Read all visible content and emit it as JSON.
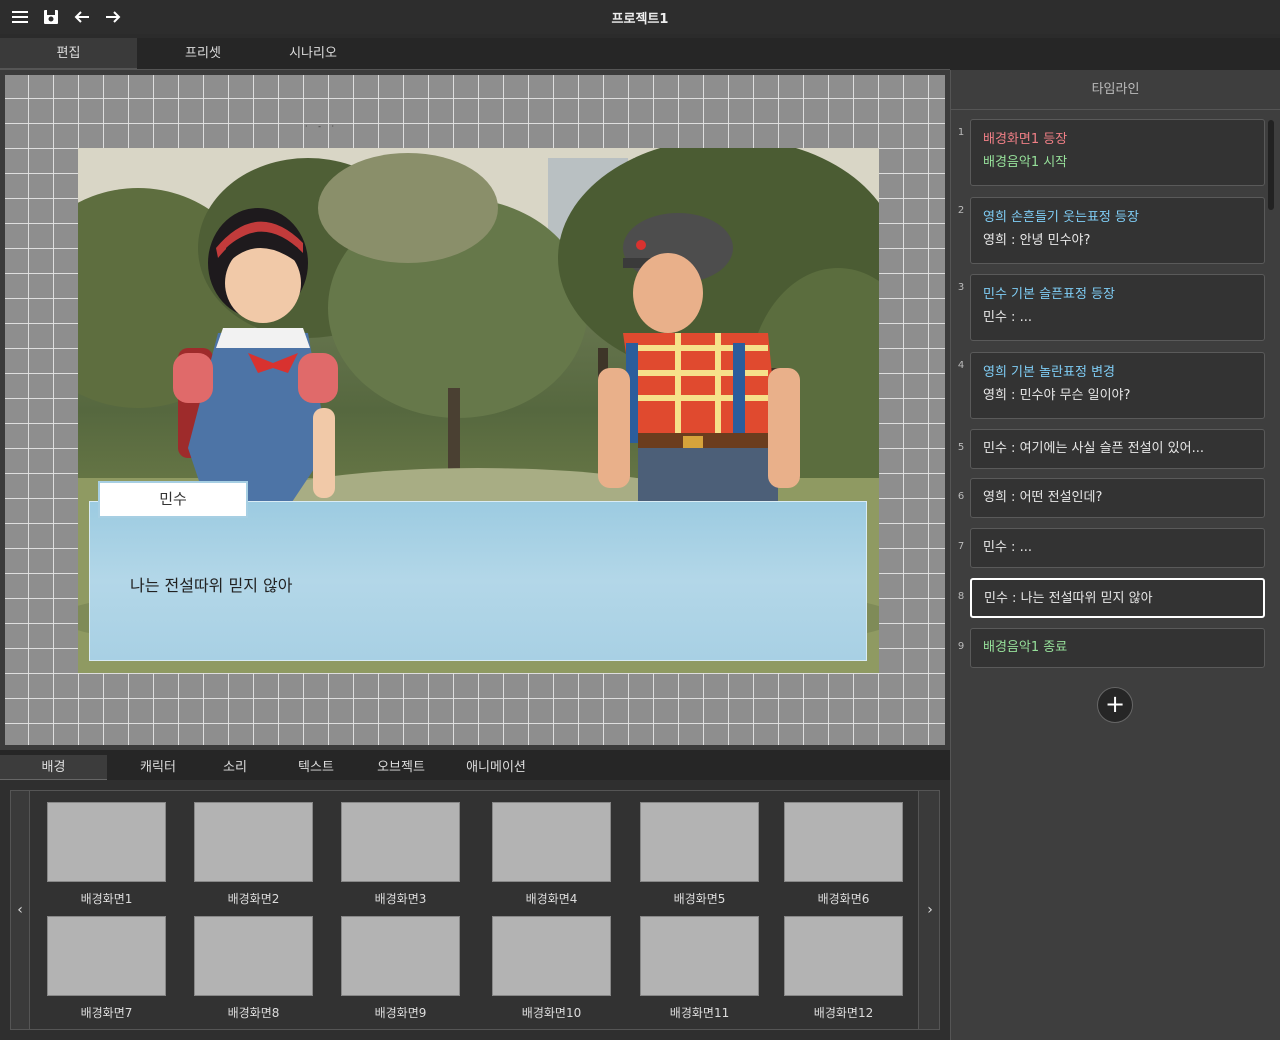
{
  "app": {
    "title": "프로젝트1"
  },
  "toolbar": {
    "icons": [
      "menu-icon",
      "save-icon",
      "undo-icon",
      "redo-icon"
    ]
  },
  "mode_tabs": [
    {
      "label": "편집",
      "active": true
    },
    {
      "label": "프리셋",
      "active": false
    },
    {
      "label": "시나리오",
      "active": false
    }
  ],
  "stage": {
    "speaker_name": "민수",
    "dialogue": "나는 전설따위 믿지 않아"
  },
  "asset_tabs": [
    {
      "label": "배경",
      "active": true
    },
    {
      "label": "캐릭터",
      "active": false
    },
    {
      "label": "소리",
      "active": false
    },
    {
      "label": "텍스트",
      "active": false
    },
    {
      "label": "오브젝트",
      "active": false
    },
    {
      "label": "애니메이션",
      "active": false
    }
  ],
  "assets": {
    "prev": "‹",
    "next": "›",
    "items": [
      "배경화면1",
      "배경화면2",
      "배경화면3",
      "배경화면4",
      "배경화면5",
      "배경화면6",
      "배경화면7",
      "배경화면8",
      "배경화면9",
      "배경화면10",
      "배경화면11",
      "배경화면12"
    ]
  },
  "timeline": {
    "header": "타임라인",
    "entries": [
      {
        "num": "1",
        "lines": [
          {
            "text": "배경화면1 등장",
            "color": "#f07f86"
          },
          {
            "text": "배경음악1 시작",
            "color": "#96e09a"
          }
        ]
      },
      {
        "num": "2",
        "lines": [
          {
            "text": "영희 손흔들기 웃는표정 등장",
            "color": "#7fcdf5"
          },
          {
            "text": "영희 : 안녕 민수야?",
            "color": "#e8e8e8"
          }
        ]
      },
      {
        "num": "3",
        "lines": [
          {
            "text": "민수 기본 슬픈표정 등장",
            "color": "#7fcdf5"
          },
          {
            "text": "민수 : ...",
            "color": "#e8e8e8"
          }
        ]
      },
      {
        "num": "4",
        "lines": [
          {
            "text": "영희 기본 놀란표정 변경",
            "color": "#7fcdf5"
          },
          {
            "text": "영희 : 민수야 무슨 일이야?",
            "color": "#e8e8e8"
          }
        ]
      },
      {
        "num": "5",
        "lines": [
          {
            "text": "민수 : 여기에는 사실 슬픈 전설이 있어...",
            "color": "#e8e8e8"
          }
        ]
      },
      {
        "num": "6",
        "lines": [
          {
            "text": "영희 : 어떤 전설인데?",
            "color": "#e8e8e8"
          }
        ]
      },
      {
        "num": "7",
        "lines": [
          {
            "text": "민수 : ...",
            "color": "#e8e8e8"
          }
        ]
      },
      {
        "num": "8",
        "lines": [
          {
            "text": "민수 : 나는 전설따위 믿지 않아",
            "color": "#e8e8e8"
          }
        ],
        "selected": true
      },
      {
        "num": "9",
        "lines": [
          {
            "text": "배경음악1 종료",
            "color": "#96e09a"
          }
        ]
      }
    ],
    "add_label": "+"
  }
}
